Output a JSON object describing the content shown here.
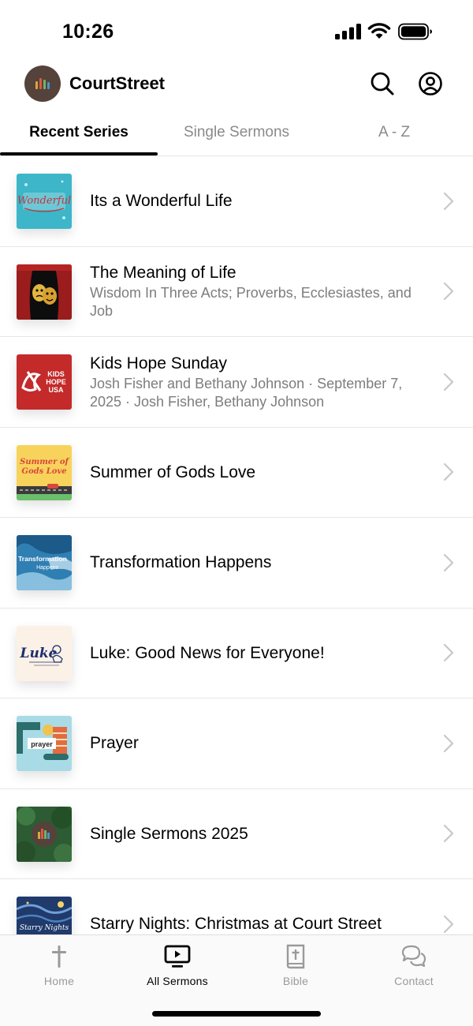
{
  "status_bar": {
    "time": "10:26"
  },
  "app": {
    "title": "CourtStreet"
  },
  "tabs": [
    {
      "label": "Recent Series",
      "active": true
    },
    {
      "label": "Single Sermons",
      "active": false
    },
    {
      "label": "A - Z",
      "active": false
    }
  ],
  "series": [
    {
      "title": "Its a Wonderful Life",
      "subtitle": ""
    },
    {
      "title": "The Meaning of Life",
      "subtitle": "Wisdom In Three Acts; Proverbs, Ecclesiastes, and Job"
    },
    {
      "title": "Kids Hope Sunday",
      "subtitle": "Josh Fisher and Bethany Johnson · September 7, 2025 · Josh Fisher, Bethany Johnson"
    },
    {
      "title": "Summer of Gods Love",
      "subtitle": ""
    },
    {
      "title": "Transformation Happens",
      "subtitle": ""
    },
    {
      "title": "Luke: Good News for Everyone!",
      "subtitle": ""
    },
    {
      "title": "Prayer",
      "subtitle": ""
    },
    {
      "title": "Single Sermons 2025",
      "subtitle": ""
    },
    {
      "title": "Starry Nights: Christmas at Court Street",
      "subtitle": ""
    }
  ],
  "thumb_text": {
    "wonderful": "Wonderful",
    "kids_hope": [
      "KIDS",
      "HOPE",
      "USA"
    ],
    "summer": [
      "Summer of",
      "Gods Love"
    ],
    "transformation": [
      "Transformation",
      "Happens..."
    ],
    "luke": "Luke",
    "prayer": "prayer",
    "starry": "Starry Nights"
  },
  "bottom_nav": [
    {
      "label": "Home",
      "icon": "cross-icon",
      "active": false
    },
    {
      "label": "All Sermons",
      "icon": "tv-play-icon",
      "active": true
    },
    {
      "label": "Bible",
      "icon": "bible-icon",
      "active": false
    },
    {
      "label": "Contact",
      "icon": "chat-bubbles-icon",
      "active": false
    }
  ],
  "colors": {
    "brand_avatar": "#55423a",
    "inactive_gray": "#9a9a9a",
    "active_black": "#000000"
  }
}
